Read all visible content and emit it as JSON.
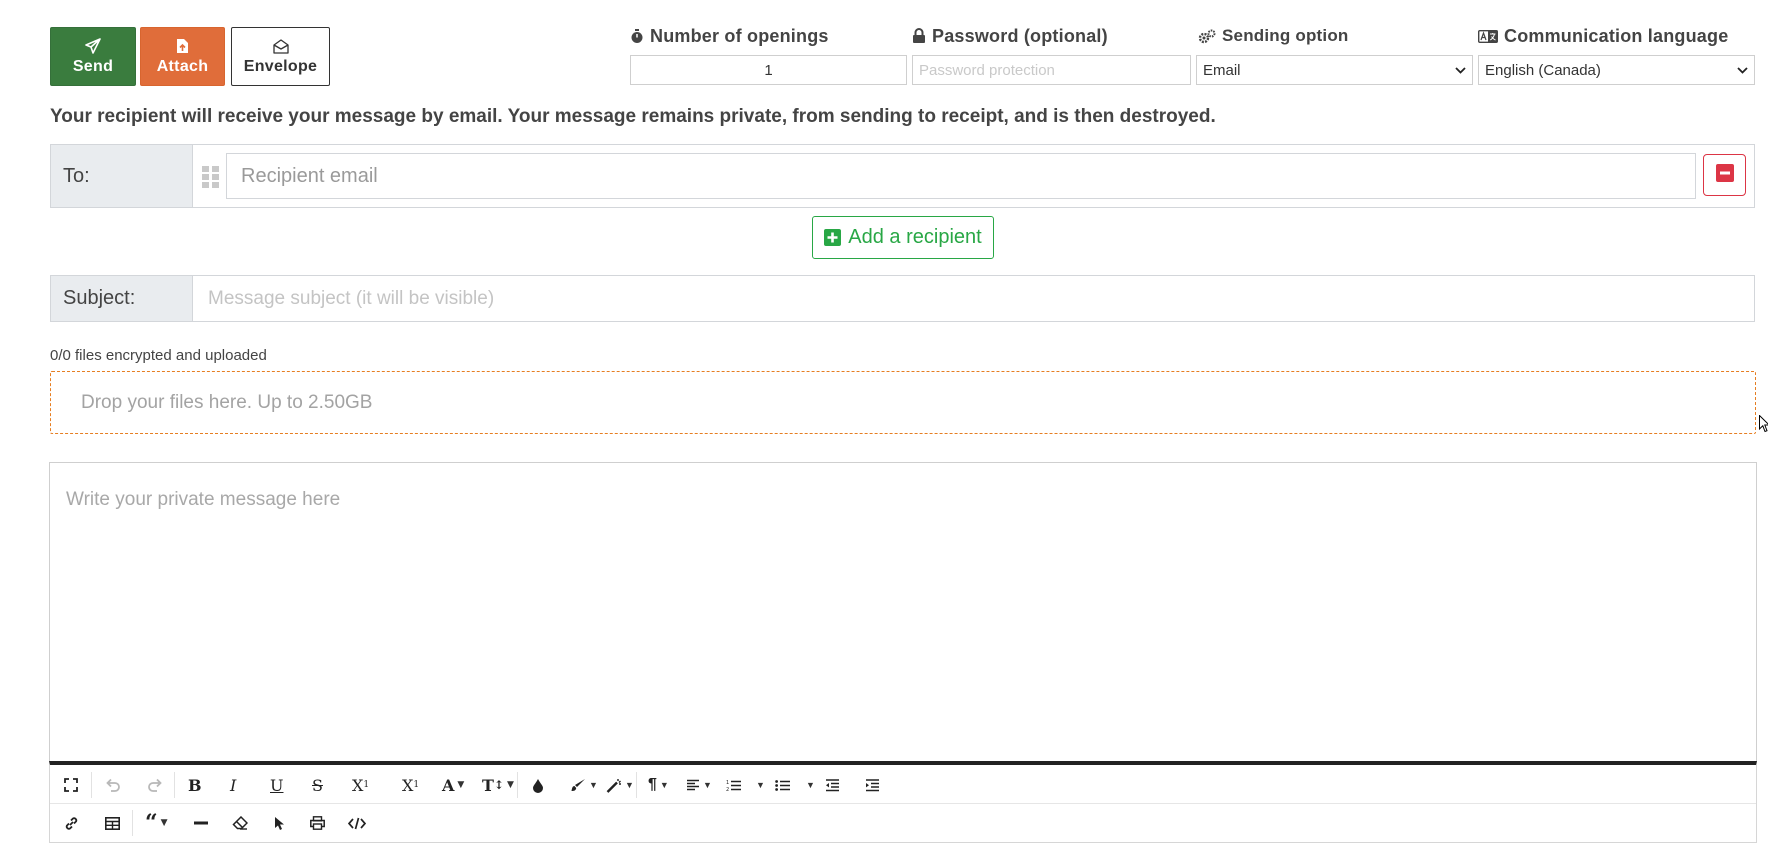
{
  "actions": {
    "send_label": "Send",
    "attach_label": "Attach",
    "envelope_label": "Envelope"
  },
  "options": {
    "openings_label": "Number of openings",
    "openings_value": "1",
    "password_label": "Password (optional)",
    "password_placeholder": "Password protection",
    "sending_label": "Sending option",
    "sending_value": "Email",
    "language_label": "Communication language",
    "language_value": "English (Canada)"
  },
  "info_text": "Your recipient will receive your message by email. Your message remains private, from sending to receipt, and is then destroyed.",
  "recipients": {
    "to_label": "To:",
    "email_placeholder": "Recipient email",
    "add_label": "Add a recipient"
  },
  "subject": {
    "label": "Subject:",
    "placeholder": "Message subject (it will be visible)"
  },
  "files": {
    "status": "0/0 files encrypted and uploaded",
    "drop_text": "Drop your files here. Up to 2.50GB"
  },
  "editor": {
    "placeholder": "Write your private message here",
    "toolbar_row1": [
      "fullscreen-icon",
      "undo-icon",
      "redo-icon",
      "bold-icon",
      "italic-icon",
      "underline-icon",
      "strikethrough-icon",
      "subscript-icon",
      "superscript-icon",
      "font-family-icon",
      "font-size-icon",
      "text-color-icon",
      "background-color-icon",
      "inline-style-icon",
      "paragraph-format-icon",
      "align-icon",
      "ordered-list-icon",
      "unordered-list-icon",
      "outdent-icon",
      "indent-icon"
    ],
    "toolbar_row2": [
      "link-icon",
      "table-icon",
      "quote-icon",
      "horizontal-line-icon",
      "clear-formatting-icon",
      "select-all-icon",
      "print-icon",
      "code-view-icon"
    ]
  },
  "colors": {
    "send": "#3a7c3e",
    "attach": "#e06d3a",
    "success": "#28a745",
    "danger": "#dc3545",
    "drop_border": "#e67e22"
  }
}
